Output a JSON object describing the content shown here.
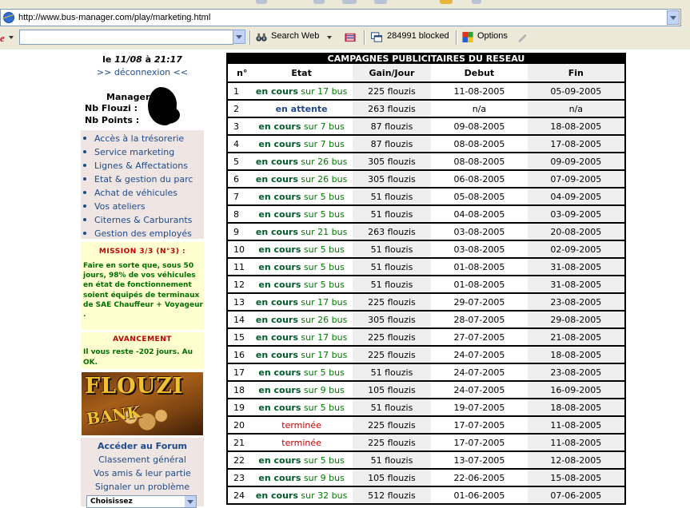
{
  "browser": {
    "url": "http://www.bus-manager.com/play/marketing.html",
    "brand": "e",
    "toolbar": {
      "search_web": "Search Web",
      "popups_blocked": "284991 blocked",
      "options": "Options"
    }
  },
  "sidebar": {
    "date_prefix": "le",
    "date": "11/08",
    "date_sep": "à",
    "time": "21:17",
    "logout": ">> déconnexion <<",
    "manager_label": "Manager",
    "flouzi_label": "Nb Flouzi :",
    "points_label": "Nb Points :",
    "menu": [
      "Accès à la trésorerie",
      "Service marketing",
      "Lignes & Affectations",
      "Etat & gestion du parc",
      "Achat de véhicules",
      "Vos ateliers",
      "Citernes & Carburants",
      "Gestion des employés"
    ],
    "mission_title": "MISSION 3/3 (N°3) :",
    "mission_text": "Faire en sorte que, sous 50 jours, 98% de vos véhicules en état de fonctionnement soient équipés de terminaux de SAE Chauffeur + Voyageur .",
    "progress_title": "AVANCEMENT",
    "progress_text": "Il vous reste -202 jours. Au OK.",
    "bank_word1": "FLOUZI",
    "bank_word2": "BANK",
    "forum": "Accéder au Forum",
    "ranking": "Classement général",
    "friends": "Vos amis & leur partie",
    "report": "Signaler un problème",
    "select_value": "Choisissez"
  },
  "table": {
    "title": "CAMPAGNES PUBLICITAIRES DU RESEAU",
    "headers": [
      "n°",
      "Etat",
      "Gain/Jour",
      "Debut",
      "Fin"
    ],
    "rows": [
      {
        "n": "1",
        "s1": "en cours",
        "s2": " sur 17 bus",
        "gain": "225 flouzis",
        "debut": "11-08-2005",
        "fin": "05-09-2005",
        "kind": "running"
      },
      {
        "n": "2",
        "s1": "en attente",
        "s2": "",
        "gain": "263 flouzis",
        "debut": "n/a",
        "fin": "n/a",
        "kind": "waiting"
      },
      {
        "n": "3",
        "s1": "en cours",
        "s2": " sur 7 bus",
        "gain": "87 flouzis",
        "debut": "09-08-2005",
        "fin": "18-08-2005",
        "kind": "running"
      },
      {
        "n": "4",
        "s1": "en cours",
        "s2": " sur 7 bus",
        "gain": "87 flouzis",
        "debut": "08-08-2005",
        "fin": "17-08-2005",
        "kind": "running"
      },
      {
        "n": "5",
        "s1": "en cours",
        "s2": " sur 26 bus",
        "gain": "305 flouzis",
        "debut": "08-08-2005",
        "fin": "09-09-2005",
        "kind": "running"
      },
      {
        "n": "6",
        "s1": "en cours",
        "s2": " sur 26 bus",
        "gain": "305 flouzis",
        "debut": "06-08-2005",
        "fin": "07-09-2005",
        "kind": "running"
      },
      {
        "n": "7",
        "s1": "en cours",
        "s2": " sur 5 bus",
        "gain": "51 flouzis",
        "debut": "05-08-2005",
        "fin": "04-09-2005",
        "kind": "running"
      },
      {
        "n": "8",
        "s1": "en cours",
        "s2": " sur 5 bus",
        "gain": "51 flouzis",
        "debut": "04-08-2005",
        "fin": "03-09-2005",
        "kind": "running"
      },
      {
        "n": "9",
        "s1": "en cours",
        "s2": " sur 21 bus",
        "gain": "263 flouzis",
        "debut": "03-08-2005",
        "fin": "20-08-2005",
        "kind": "running"
      },
      {
        "n": "10",
        "s1": "en cours",
        "s2": " sur 5 bus",
        "gain": "51 flouzis",
        "debut": "03-08-2005",
        "fin": "02-09-2005",
        "kind": "running"
      },
      {
        "n": "11",
        "s1": "en cours",
        "s2": " sur 5 bus",
        "gain": "51 flouzis",
        "debut": "01-08-2005",
        "fin": "31-08-2005",
        "kind": "running"
      },
      {
        "n": "12",
        "s1": "en cours",
        "s2": " sur 5 bus",
        "gain": "51 flouzis",
        "debut": "01-08-2005",
        "fin": "31-08-2005",
        "kind": "running"
      },
      {
        "n": "13",
        "s1": "en cours",
        "s2": " sur 17 bus",
        "gain": "225 flouzis",
        "debut": "29-07-2005",
        "fin": "23-08-2005",
        "kind": "running"
      },
      {
        "n": "14",
        "s1": "en cours",
        "s2": " sur 26 bus",
        "gain": "305 flouzis",
        "debut": "28-07-2005",
        "fin": "29-08-2005",
        "kind": "running"
      },
      {
        "n": "15",
        "s1": "en cours",
        "s2": " sur 17 bus",
        "gain": "225 flouzis",
        "debut": "27-07-2005",
        "fin": "21-08-2005",
        "kind": "running"
      },
      {
        "n": "16",
        "s1": "en cours",
        "s2": " sur 17 bus",
        "gain": "225 flouzis",
        "debut": "24-07-2005",
        "fin": "18-08-2005",
        "kind": "running"
      },
      {
        "n": "17",
        "s1": "en cours",
        "s2": " sur 5 bus",
        "gain": "51 flouzis",
        "debut": "24-07-2005",
        "fin": "23-08-2005",
        "kind": "running"
      },
      {
        "n": "18",
        "s1": "en cours",
        "s2": " sur 9 bus",
        "gain": "105 flouzis",
        "debut": "24-07-2005",
        "fin": "16-09-2005",
        "kind": "running"
      },
      {
        "n": "19",
        "s1": "en cours",
        "s2": " sur 5 bus",
        "gain": "51 flouzis",
        "debut": "19-07-2005",
        "fin": "18-08-2005",
        "kind": "running"
      },
      {
        "n": "20",
        "s1": "terminée",
        "s2": "",
        "gain": "225 flouzis",
        "debut": "17-07-2005",
        "fin": "11-08-2005",
        "kind": "done"
      },
      {
        "n": "21",
        "s1": "terminée",
        "s2": "",
        "gain": "225 flouzis",
        "debut": "17-07-2005",
        "fin": "11-08-2005",
        "kind": "done"
      },
      {
        "n": "22",
        "s1": "en cours",
        "s2": " sur 5 bus",
        "gain": "51 flouzis",
        "debut": "13-07-2005",
        "fin": "12-08-2005",
        "kind": "running"
      },
      {
        "n": "23",
        "s1": "en cours",
        "s2": " sur 9 bus",
        "gain": "105 flouzis",
        "debut": "22-06-2005",
        "fin": "15-08-2005",
        "kind": "running"
      },
      {
        "n": "24",
        "s1": "en cours",
        "s2": " sur 32 bus",
        "gain": "512 flouzis",
        "debut": "01-06-2005",
        "fin": "07-06-2005",
        "kind": "running"
      }
    ]
  }
}
